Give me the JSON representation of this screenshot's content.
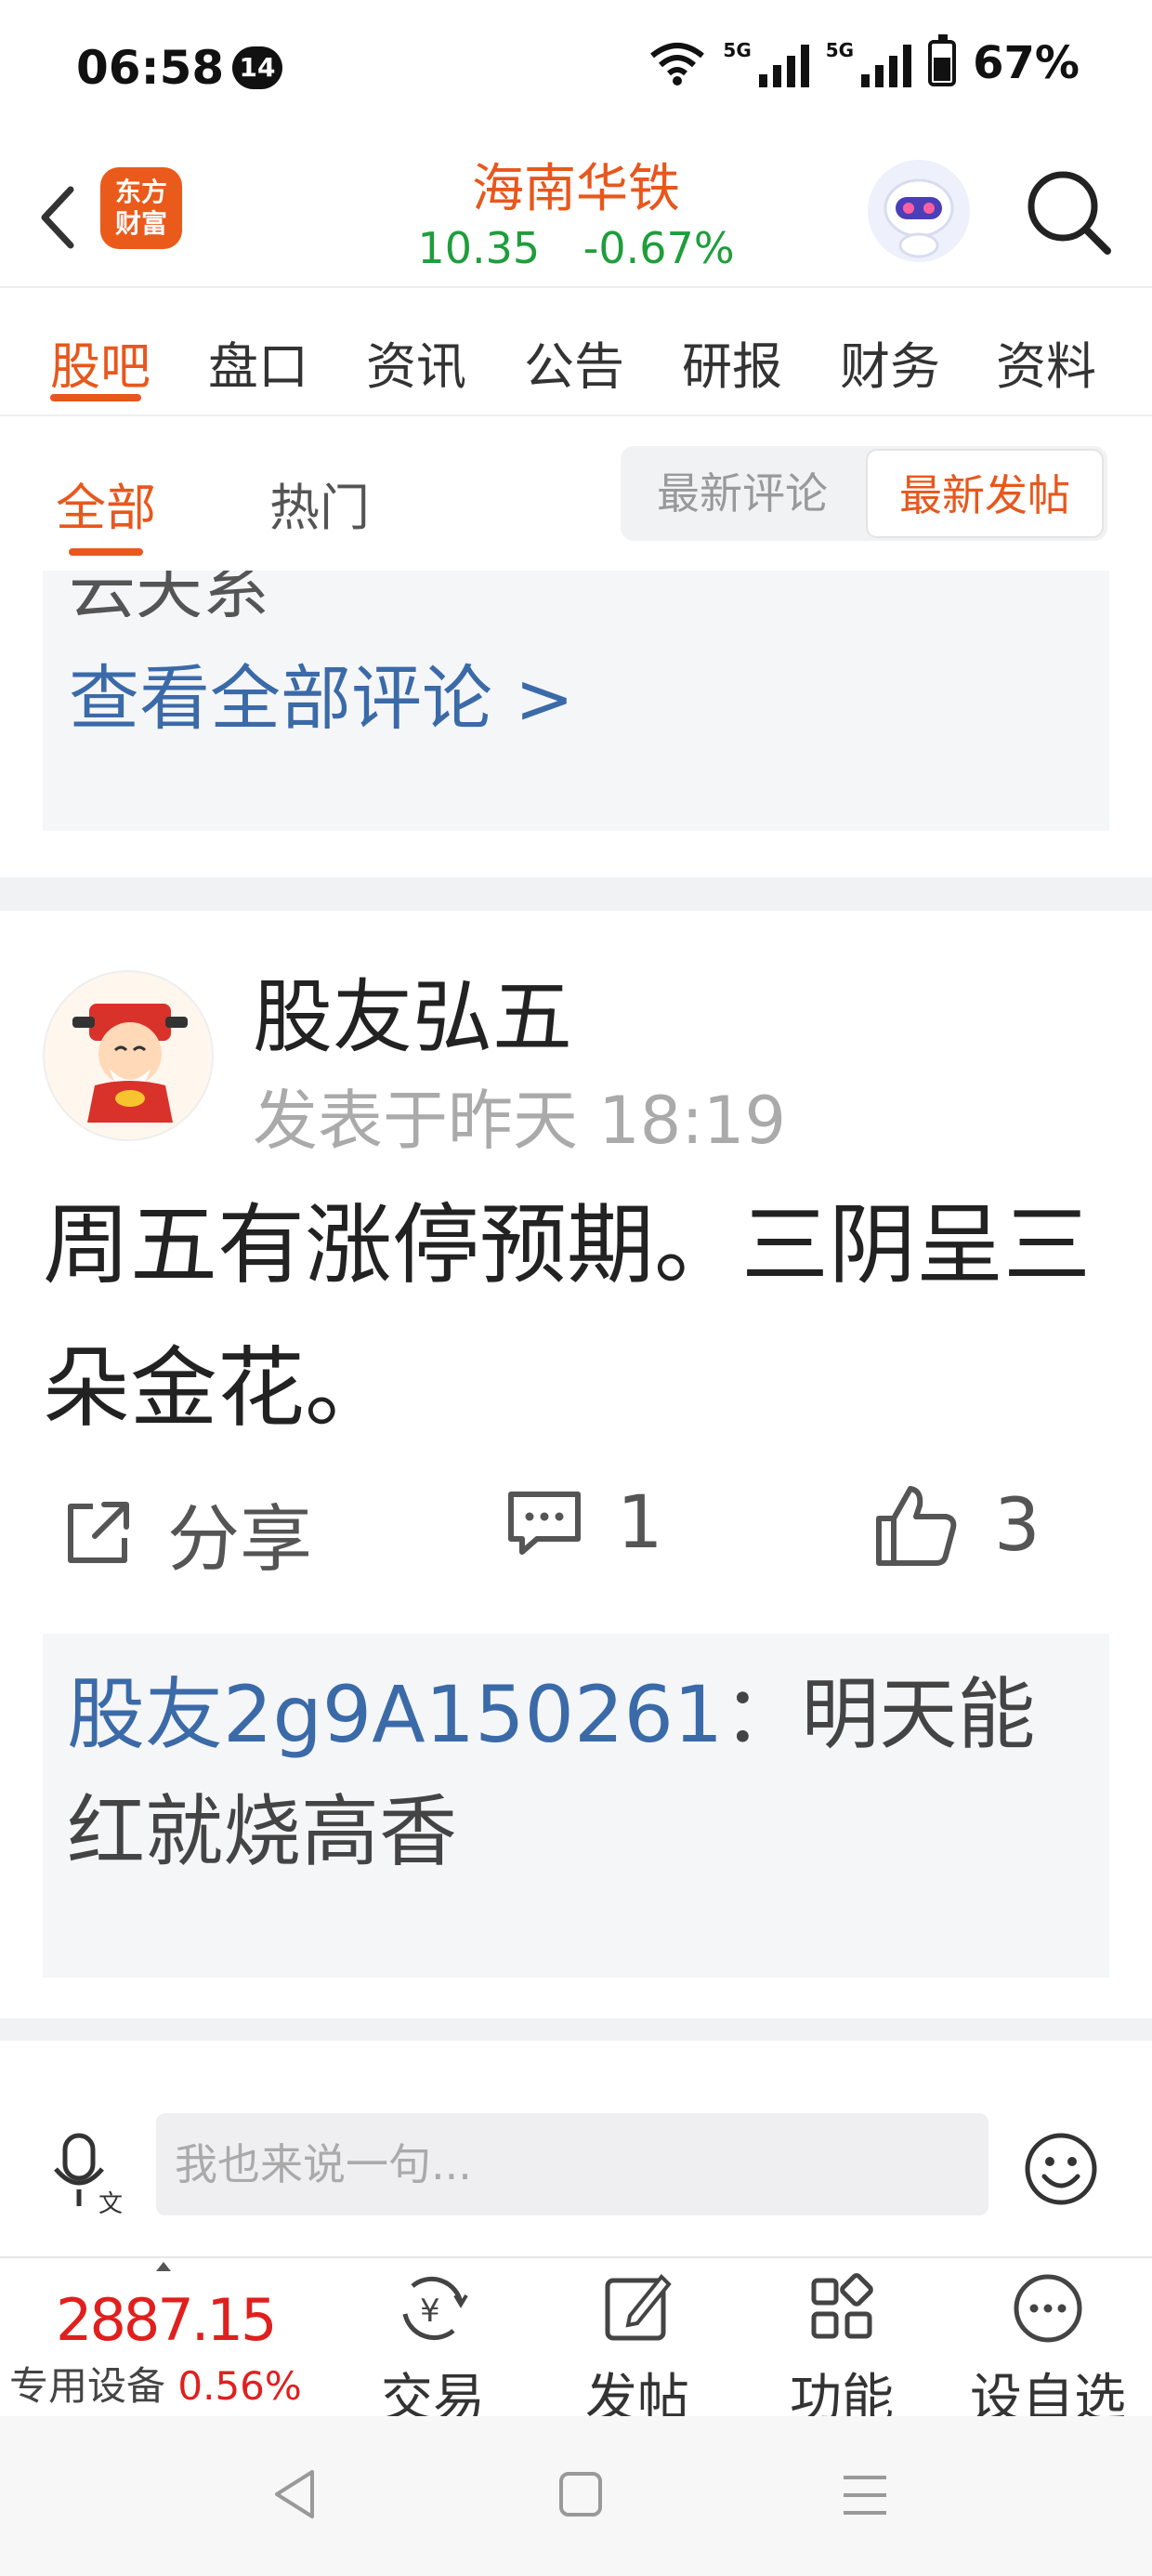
{
  "status_bar": {
    "time": "06:58",
    "notification_count": "14",
    "network_1": "5G",
    "network_2": "5G",
    "battery": "67%"
  },
  "header": {
    "app_logo_line1": "东方",
    "app_logo_line2": "财富",
    "stock_name": "海南华铁",
    "price": "10.35",
    "change": "-0.67%",
    "colors": {
      "brand": "#e8571c",
      "down": "#1f9d3c"
    }
  },
  "tabs": [
    "股吧",
    "盘口",
    "资讯",
    "公告",
    "研报",
    "财务",
    "资料"
  ],
  "filter": {
    "all": "全部",
    "hot": "热门",
    "latest_comment": "最新评论",
    "latest_post": "最新发帖"
  },
  "prev_post": {
    "truncated_text": "云天系",
    "view_all": "查看全部评论 >"
  },
  "post": {
    "author": "股友弘五",
    "time": "发表于昨天 18:19",
    "body": "周五有涨停预期。三阴呈三朵金花。",
    "share_label": "分享",
    "comment_count": "1",
    "like_count": "3",
    "reply": {
      "user": "股友2g9A150261",
      "separator": "：",
      "text": "明天能红就烧高香"
    }
  },
  "comment_bar": {
    "placeholder": "我也来说一句..."
  },
  "bottom_nav": {
    "index_value": "2887.15",
    "index_name": "专用设备",
    "index_change": "0.56%",
    "items": [
      "交易",
      "发帖",
      "功能",
      "设自选"
    ]
  }
}
